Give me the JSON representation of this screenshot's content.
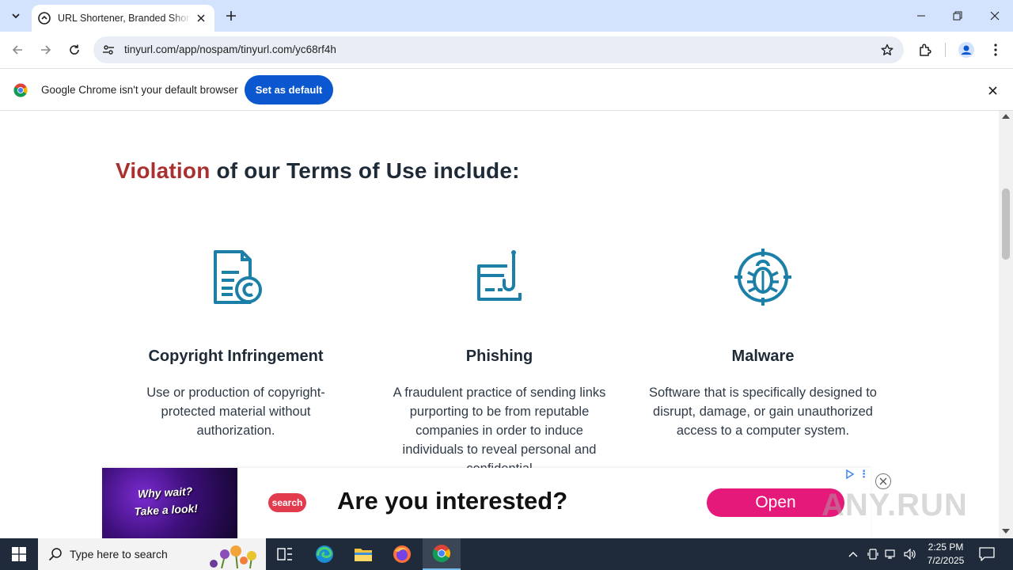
{
  "browser": {
    "tab_title": "URL Shortener, Branded Short Links & Analytics | TinyURL",
    "url": "tinyurl.com/app/nospam/tinyurl.com/yc68rf4h"
  },
  "infobar": {
    "message": "Google Chrome isn't your default browser",
    "button": "Set as default"
  },
  "page": {
    "heading_accent": "Violation",
    "heading_rest": " of our Terms of Use include:",
    "columns": [
      {
        "icon": "copyright-document-icon",
        "title": "Copyright Infringement",
        "desc": "Use or production of copyright-protected material without authorization."
      },
      {
        "icon": "phishing-hook-icon",
        "title": "Phishing",
        "desc": "A fraudulent practice of sending links purporting to be from reputable companies in order to induce individuals to reveal personal and confidential"
      },
      {
        "icon": "malware-bug-icon",
        "title": "Malware",
        "desc": "Software that is specifically designed to disrupt, damage, or gain unauthorized access to a computer system."
      }
    ],
    "accent_color": "#a8312f",
    "icon_color": "#1b7fa8"
  },
  "ad": {
    "image_text_line1": "Why wait?",
    "image_text_line2": "Take a look!",
    "logo_text": "search",
    "headline": "Are you interested?",
    "cta": "Open"
  },
  "watermark": "ANY.RUN",
  "taskbar": {
    "search_placeholder": "Type here to search",
    "time": "2:25 PM",
    "date": "7/2/2025"
  }
}
